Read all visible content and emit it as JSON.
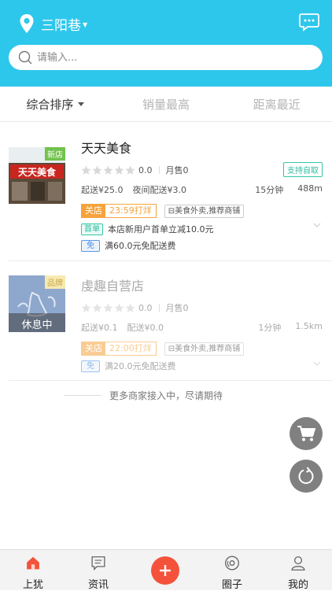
{
  "header": {
    "location": "三阳巷",
    "search_placeholder": "请输入..."
  },
  "sort_tabs": [
    {
      "label": "综合排序",
      "active": true
    },
    {
      "label": "销量最高",
      "active": false
    },
    {
      "label": "距离最近",
      "active": false
    }
  ],
  "shops": [
    {
      "name": "天天美食",
      "badge": "新店",
      "rating": "0.0",
      "monthly_sales": "月售0",
      "self_pickup": "支持自取",
      "min_order": "起送¥25.0",
      "delivery_fee": "夜间配送¥3.0",
      "delivery_time": "15分钟",
      "distance": "488m",
      "status": "关店",
      "status_time": "23:59打烊",
      "category": "美食外卖,推荐商铺",
      "promos": [
        {
          "badge": "首单",
          "text": "本店新用户首单立减10.0元"
        },
        {
          "badge": "免",
          "text": "满60.0元免配送费"
        }
      ]
    },
    {
      "name": "虔趣自营店",
      "badge": "品牌",
      "overlay": "休息中",
      "rating": "0.0",
      "monthly_sales": "月售0",
      "min_order": "起送¥0.1",
      "delivery_fee": "配送¥0.0",
      "delivery_time": "1分钟",
      "distance": "1.5km",
      "status": "关店",
      "status_time": "22:00打烊",
      "category": "美食外卖,推荐商铺",
      "promos": [
        {
          "badge": "免",
          "text": "满20.0元免配送费"
        }
      ]
    }
  ],
  "footer_note": "更多商家接入中，尽请期待",
  "tabbar": [
    {
      "label": "上犹",
      "icon": "home-icon"
    },
    {
      "label": "资讯",
      "icon": "news-icon"
    },
    {
      "label": "",
      "icon": "plus-icon"
    },
    {
      "label": "圈子",
      "icon": "circle-icon"
    },
    {
      "label": "我的",
      "icon": "user-icon"
    }
  ],
  "colors": {
    "header": "#2ec7ec",
    "accent_orange": "#f5a33b",
    "accent_green": "#33c6a7",
    "add_button": "#f4523b"
  }
}
